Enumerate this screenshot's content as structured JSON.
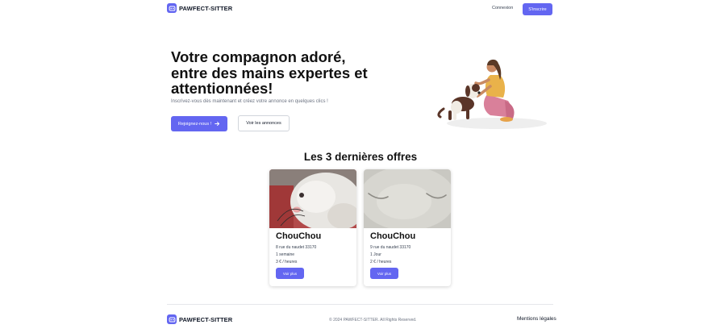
{
  "header": {
    "brand": "PAWFECT-SITTER",
    "login_label": "Connexion",
    "signup_label": "S'inscrire",
    "accent_color": "#6366f1"
  },
  "hero": {
    "title_lines": [
      "Votre compagnon adoré,",
      "entre des mains expertes et",
      "attentionnées!"
    ],
    "subtitle": "Inscrivez-vous dès maintenant et créez votre annonce en quelques clics !",
    "primary_button": "Rejoignez-nous !",
    "secondary_button": "Voir les annonces",
    "illustration_icon": "woman-petting-dog-illustration"
  },
  "offers": {
    "title": "Les 3 dernières offres",
    "cards": [
      {
        "name": "ChouChou",
        "address": "8 rue du naudet 33170",
        "duration": "1 semaine",
        "price": "3 € / heures",
        "button": "Voir plus",
        "photo": "white-rabbit-photo"
      },
      {
        "name": "ChouChou",
        "address": "9 rue du naudet 33170",
        "duration": "1 Jour",
        "price": "2 € / heures",
        "button": "Voir plus",
        "photo": "white-rabbit-closeup-photo"
      }
    ]
  },
  "footer": {
    "brand": "PAWFECT-SITTER",
    "copyright": "© 2024 PAWFECT-SITTER. All Rights Reserved.",
    "legal_link": "Mentions légales"
  }
}
